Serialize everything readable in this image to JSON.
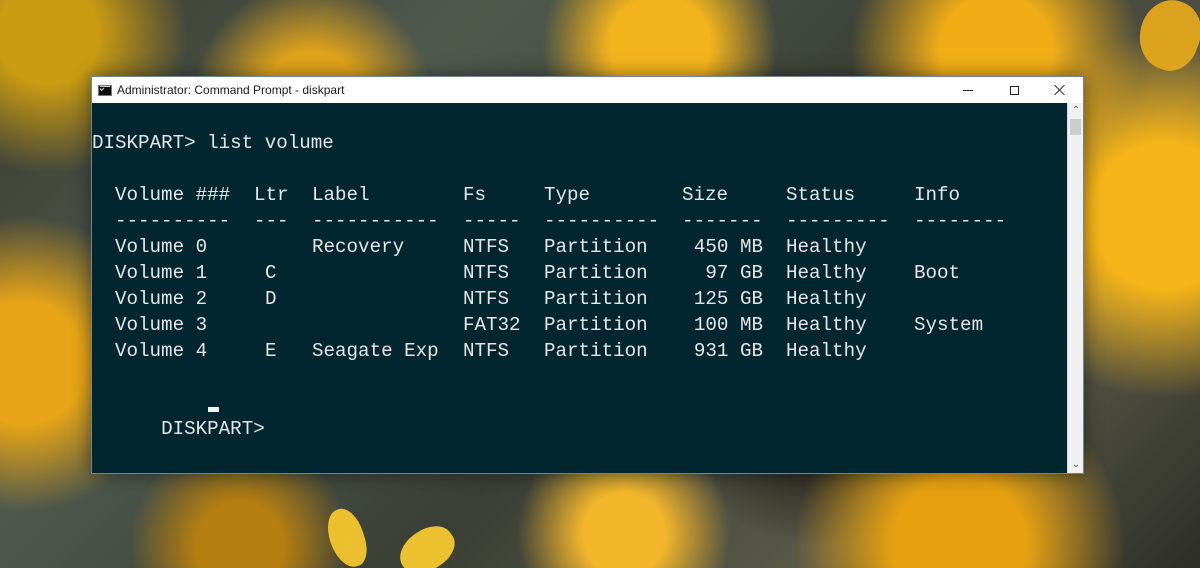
{
  "window": {
    "title": "Administrator: Command Prompt - diskpart"
  },
  "console": {
    "command_line": "DISKPART> list volume",
    "prompt_line": "DISKPART> ",
    "headers": [
      "Volume ###",
      "Ltr",
      "Label",
      "Fs",
      "Type",
      "Size",
      "Status",
      "Info"
    ],
    "separators": [
      "----------",
      "---",
      "-----------",
      "-----",
      "----------",
      "-------",
      "---------",
      "--------"
    ],
    "rows": [
      [
        "Volume 0",
        "",
        "Recovery",
        "NTFS",
        "Partition",
        "450 MB",
        "Healthy",
        ""
      ],
      [
        "Volume 1",
        "C",
        "",
        "NTFS",
        "Partition",
        "97 GB",
        "Healthy",
        "Boot"
      ],
      [
        "Volume 2",
        "D",
        "",
        "NTFS",
        "Partition",
        "125 GB",
        "Healthy",
        ""
      ],
      [
        "Volume 3",
        "",
        "",
        "FAT32",
        "Partition",
        "100 MB",
        "Healthy",
        "System"
      ],
      [
        "Volume 4",
        "E",
        "Seagate Exp",
        "NTFS",
        "Partition",
        "931 GB",
        "Healthy",
        ""
      ]
    ]
  },
  "icons": {
    "window_icon": "cmd-icon",
    "minimize": "minimize-icon",
    "maximize": "maximize-icon",
    "close": "close-icon",
    "scroll_up": "chevron-up-icon",
    "scroll_down": "chevron-down-icon"
  },
  "colors": {
    "console_background": "#012630",
    "console_text": "#e6e6e6",
    "titlebar_background": "#ffffff"
  }
}
